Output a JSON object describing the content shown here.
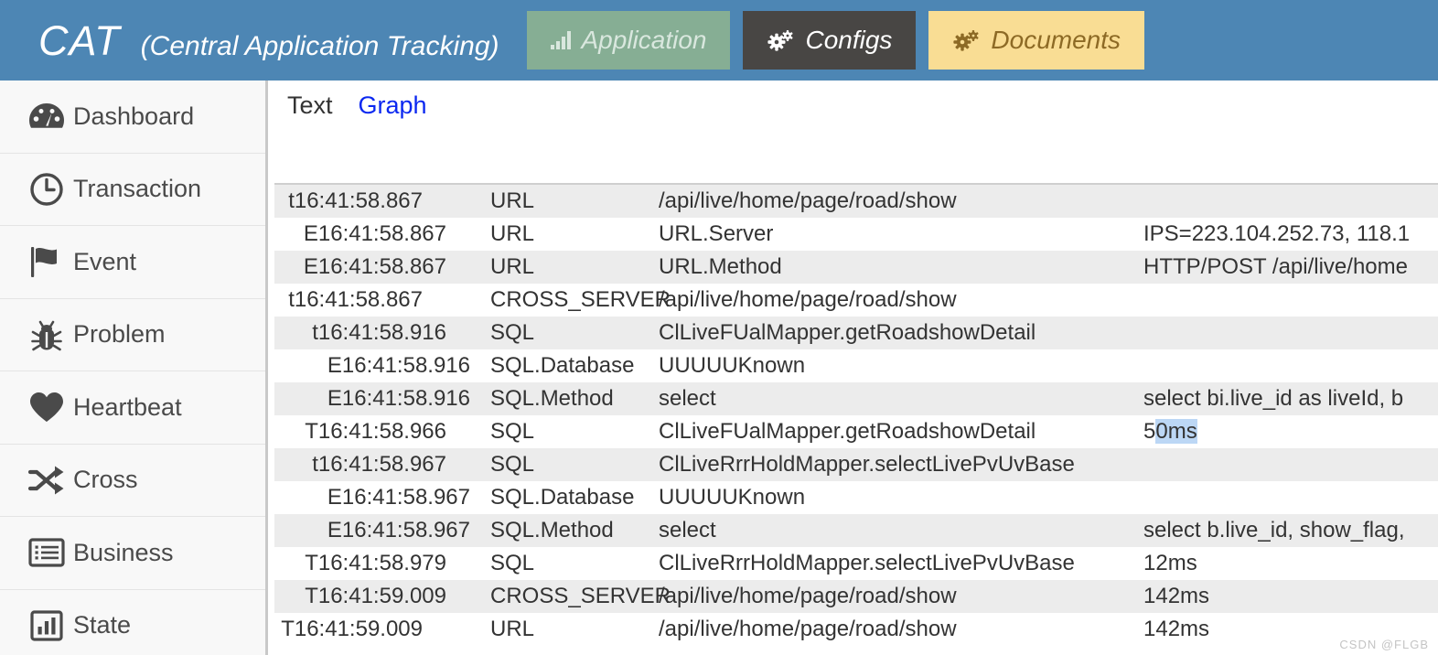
{
  "header": {
    "brand_abbr": "CAT",
    "brand_full": "(Central Application Tracking)",
    "nav": [
      {
        "label": "Application",
        "icon": "bar-chart-icon",
        "bg": "#86ae94",
        "fg": "#d9e7de"
      },
      {
        "label": "Configs",
        "icon": "gears-icon",
        "bg": "#484644",
        "fg": "#ffffff"
      },
      {
        "label": "Documents",
        "icon": "gears-icon",
        "bg": "#f9dd94",
        "fg": "#8d6a25"
      }
    ],
    "background": "#4d86b4"
  },
  "sidebar": {
    "items": [
      {
        "label": "Dashboard",
        "icon": "dashboard-gauge-icon"
      },
      {
        "label": "Transaction",
        "icon": "clock-icon"
      },
      {
        "label": "Event",
        "icon": "flag-icon"
      },
      {
        "label": "Problem",
        "icon": "bug-icon"
      },
      {
        "label": "Heartbeat",
        "icon": "heart-icon"
      },
      {
        "label": "Cross",
        "icon": "shuffle-icon"
      },
      {
        "label": "Business",
        "icon": "list-icon"
      },
      {
        "label": "State",
        "icon": "bar-chart-icon"
      }
    ]
  },
  "main": {
    "tabs": [
      {
        "label": "Text",
        "active": false,
        "color": "#333333"
      },
      {
        "label": "Graph",
        "active": true,
        "color": "#0b28f0"
      }
    ],
    "rows": [
      {
        "timestamp": "t16:41:58.867",
        "type": "URL",
        "name": "/api/live/home/page/road/show",
        "value": "",
        "indent": 0,
        "alt": true,
        "selected": false
      },
      {
        "timestamp": "E16:41:58.867",
        "type": "URL",
        "name": "URL.Server",
        "value": "IPS=223.104.252.73, 118.1",
        "indent": 1,
        "alt": false,
        "selected": false
      },
      {
        "timestamp": "E16:41:58.867",
        "type": "URL",
        "name": "URL.Method",
        "value": "HTTP/POST /api/live/home",
        "indent": 1,
        "alt": true,
        "selected": false
      },
      {
        "timestamp": "t16:41:58.867",
        "type": "CROSS_SERVER",
        "name": "/api/live/home/page/road/show",
        "value": "",
        "indent": 0,
        "alt": false,
        "selected": false
      },
      {
        "timestamp": "t16:41:58.916",
        "type": "SQL",
        "name": "ClLiveFUalMapper.getRoadshowDetail",
        "value": "",
        "indent": 1,
        "alt": true,
        "selected": false
      },
      {
        "timestamp": "E16:41:58.916",
        "type": "SQL.Database",
        "name": "UUUUUKnown",
        "value": "",
        "indent": 2,
        "alt": false,
        "selected": false
      },
      {
        "timestamp": "E16:41:58.916",
        "type": "SQL.Method",
        "name": "select",
        "value": "select bi.live_id as liveId, b",
        "indent": 2,
        "alt": true,
        "selected": false
      },
      {
        "timestamp": "T16:41:58.966",
        "type": "SQL",
        "name": "ClLiveFUalMapper.getRoadshowDetail",
        "value": "50ms",
        "indent": 1,
        "alt": false,
        "selected": true
      },
      {
        "timestamp": "t16:41:58.967",
        "type": "SQL",
        "name": "ClLiveRrrHoldMapper.selectLivePvUvBase",
        "value": "",
        "indent": 1,
        "alt": true,
        "selected": false
      },
      {
        "timestamp": "E16:41:58.967",
        "type": "SQL.Database",
        "name": "UUUUUKnown",
        "value": "",
        "indent": 2,
        "alt": false,
        "selected": false
      },
      {
        "timestamp": "E16:41:58.967",
        "type": "SQL.Method",
        "name": "select",
        "value": "select b.live_id, show_flag,",
        "indent": 2,
        "alt": true,
        "selected": false
      },
      {
        "timestamp": "T16:41:58.979",
        "type": "SQL",
        "name": "ClLiveRrrHoldMapper.selectLivePvUvBase",
        "value": "12ms",
        "indent": 1,
        "alt": false,
        "selected": false
      },
      {
        "timestamp": "T16:41:59.009",
        "type": "CROSS_SERVER",
        "name": "/api/live/home/page/road/show",
        "value": "142ms",
        "indent": 1,
        "alt": true,
        "selected": false
      },
      {
        "timestamp": "T16:41:59.009",
        "type": "URL",
        "name": "/api/live/home/page/road/show",
        "value": "142ms",
        "indent": 0,
        "alt": false,
        "selected": false
      }
    ],
    "selection": {
      "row_index": 7,
      "selected_text": "0ms",
      "prefix_text": "5",
      "highlight_color": "#bcd7f5"
    }
  },
  "watermark": "CSDN @FLGB"
}
